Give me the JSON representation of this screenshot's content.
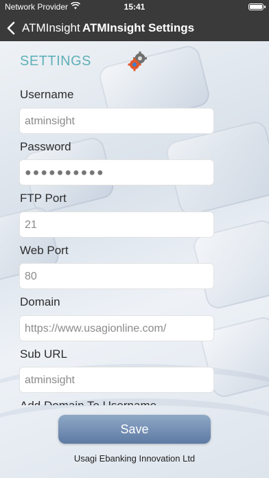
{
  "status_bar": {
    "carrier": "Network Provider",
    "time": "15:41"
  },
  "nav": {
    "back_label": "ATMInsight",
    "title": "ATMInsight Settings"
  },
  "section_title": "SETTINGS",
  "fields": [
    {
      "label": "Username",
      "value": "atminsight"
    },
    {
      "label": "Password",
      "value": "●●●●●●●●●●"
    },
    {
      "label": "FTP Port",
      "value": "21"
    },
    {
      "label": "Web Port",
      "value": "80"
    },
    {
      "label": "Domain",
      "value": "https://www.usagionline.com/"
    },
    {
      "label": "Sub URL",
      "value": "atminsight"
    },
    {
      "label": "Add Domain To Username",
      "value": ""
    }
  ],
  "save_label": "Save",
  "footer": "Usagi Ebanking Innovation Ltd",
  "colors": {
    "header": "#3a3a3a",
    "section_title": "#5fb0b7",
    "save_button": "#6f89ae"
  }
}
